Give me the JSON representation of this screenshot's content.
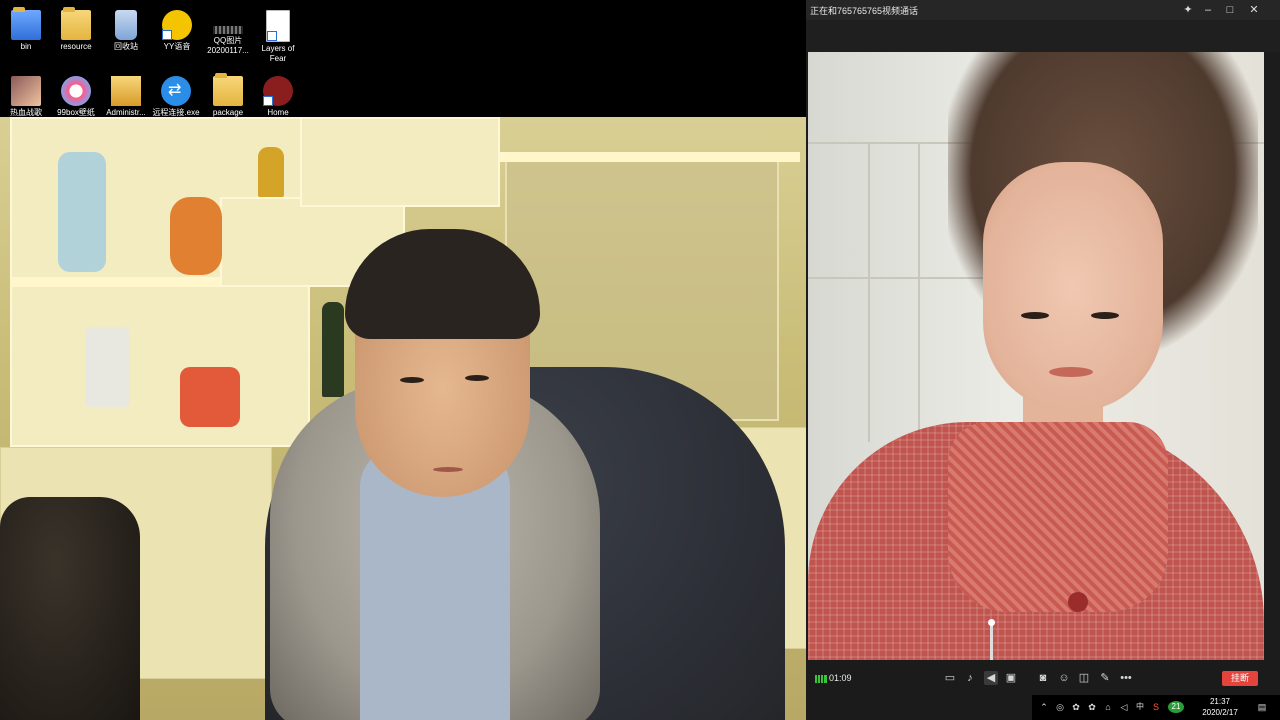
{
  "desktop": {
    "icons": [
      {
        "label": "bin"
      },
      {
        "label": "resource"
      },
      {
        "label": "回收站"
      },
      {
        "label": "YY语音"
      },
      {
        "label": "QQ图片\n20200117..."
      },
      {
        "label": "Layers of\nFear"
      },
      {
        "label": "热血战歌"
      },
      {
        "label": "99box壁纸"
      },
      {
        "label": "Administr..."
      },
      {
        "label": "远程连接.exe"
      },
      {
        "label": "package"
      },
      {
        "label": "Home"
      }
    ]
  },
  "call": {
    "title": "正在和765765765视频通话",
    "duration": "01:09",
    "hangup_label": "挂断",
    "volume_level": 0.95,
    "accent_color": "#e5443d"
  },
  "tray": {
    "badge": "21",
    "ime": "中",
    "time": "21:37",
    "date": "2020/2/17"
  }
}
